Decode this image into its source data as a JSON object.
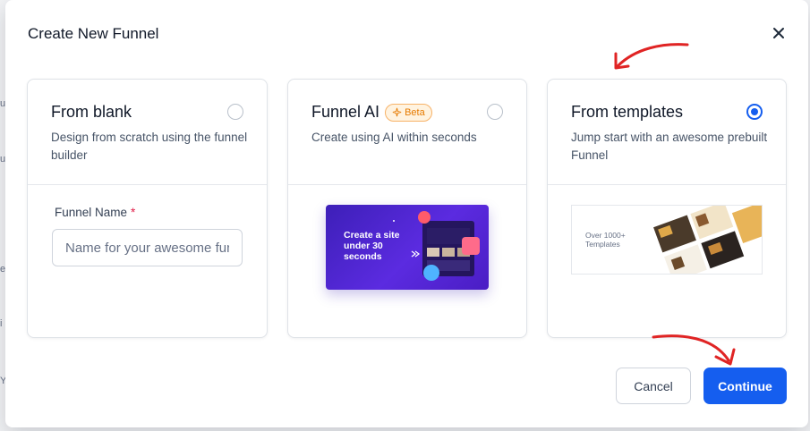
{
  "modal": {
    "title": "Create New Funnel",
    "close_icon": "close-icon"
  },
  "options": [
    {
      "title": "From blank",
      "description": "Design from scratch using the funnel builder",
      "selected": false
    },
    {
      "title": "Funnel AI",
      "badge": "Beta",
      "description": "Create using AI within seconds",
      "selected": false,
      "art_text": "Create a site under 30 seconds"
    },
    {
      "title": "From templates",
      "description": "Jump start with an awesome prebuilt Funnel",
      "selected": true,
      "art_text": "Over 1000+ Templates"
    }
  ],
  "funnel_name": {
    "label": "Funnel Name",
    "required_mark": "*",
    "placeholder": "Name for your awesome funnel",
    "value": ""
  },
  "footer": {
    "cancel_label": "Cancel",
    "continue_label": "Continue"
  },
  "colors": {
    "primary": "#155eef",
    "annotation_arrow": "#e02424",
    "beta_orange": "#e67a00"
  }
}
